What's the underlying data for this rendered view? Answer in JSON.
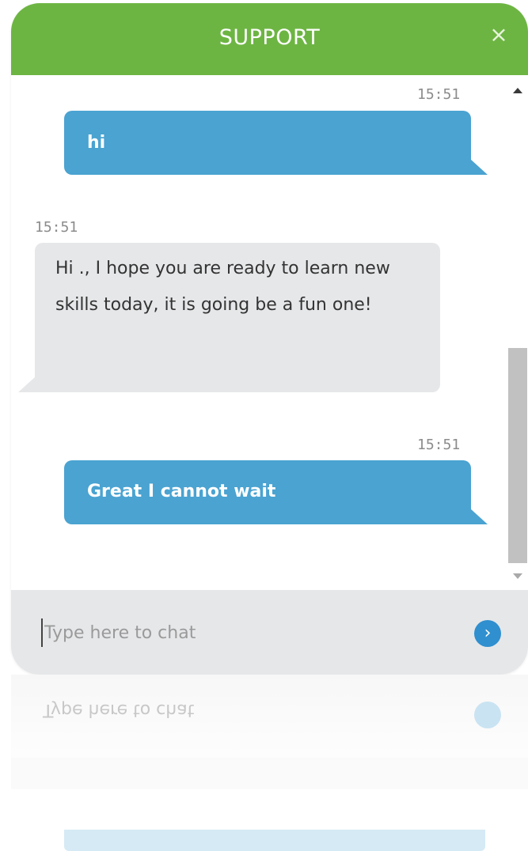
{
  "header": {
    "title": "SUPPORT",
    "close_label": "×"
  },
  "messages": [
    {
      "direction": "outgoing",
      "time": "15:51",
      "text": "hi"
    },
    {
      "direction": "incoming",
      "time": "15:51",
      "text": "Hi ., I hope you are ready to learn new skills today, it is going be a fun one!"
    },
    {
      "direction": "outgoing",
      "time": "15:51",
      "text": "Great I cannot wait"
    }
  ],
  "composer": {
    "placeholder": "Type here to chat",
    "value": "",
    "send_icon_glyph": "›"
  },
  "colors": {
    "header_bg": "#6db543",
    "outgoing_bubble": "#4aa3d1",
    "incoming_bubble": "#e6e7e9",
    "send_button": "#2f8fcf"
  },
  "icons": {
    "close": "close-icon",
    "send": "send-icon",
    "scroll_up": "scroll-up-arrow-icon",
    "scroll_down": "scroll-down-arrow-icon"
  }
}
